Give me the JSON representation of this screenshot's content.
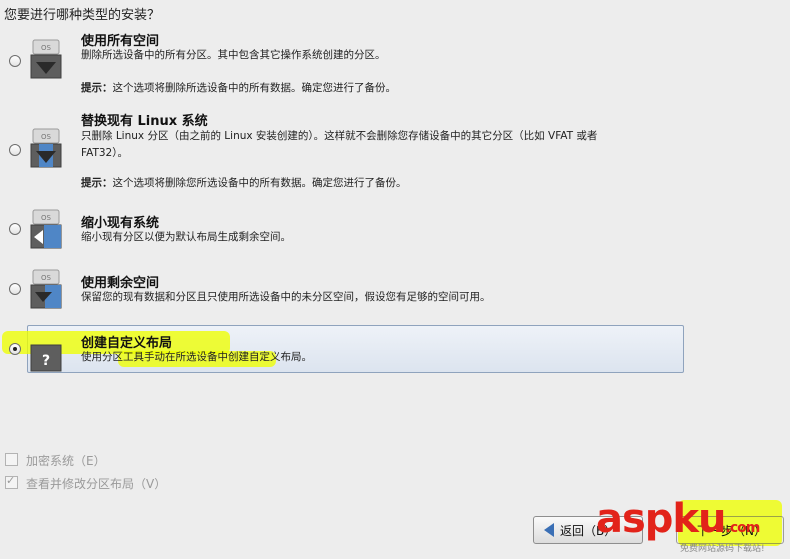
{
  "question": "您要进行哪种类型的安装？",
  "options": [
    {
      "title": "使用所有空间",
      "desc": "删除所选设备中的所有分区。其中包含其它操作系统创建的分区。",
      "tip_label": "提示：",
      "tip_text": "这个选项将删除所选设备中的所有数据。确定您进行了备份。",
      "selected": false
    },
    {
      "title": "替换现有 Linux 系统",
      "desc": "只删除 Linux 分区（由之前的 Linux 安装创建的）。这样就不会删除您存储设备中的其它分区（比如 VFAT 或者 FAT32）。",
      "tip_label": "提示：",
      "tip_text": "这个选项将删除您所选设备中的所有数据。确定您进行了备份。",
      "selected": false
    },
    {
      "title": "缩小现有系统",
      "desc": "缩小现有分区以便为默认布局生成剩余空间。",
      "selected": false
    },
    {
      "title": "使用剩余空间",
      "desc": "保留您的现有数据和分区且只使用所选设备中的未分区空间，假设您有足够的空间可用。",
      "selected": false
    },
    {
      "title": "创建自定义布局",
      "desc": "使用分区工具手动在所选设备中创建自定义布局。",
      "selected": true
    }
  ],
  "disk_label": "OS",
  "custom_label": "?",
  "checkboxes": [
    {
      "label": "加密系统（E）",
      "checked": false
    },
    {
      "label": "查看并修改分区布局（V）",
      "checked": true
    }
  ],
  "buttons": {
    "back_label": "返回（B）",
    "next_label": "下一步（N）"
  },
  "watermark": {
    "brand": "aspku",
    "tld": ".com",
    "sub": "免费网站源码下载站!"
  }
}
